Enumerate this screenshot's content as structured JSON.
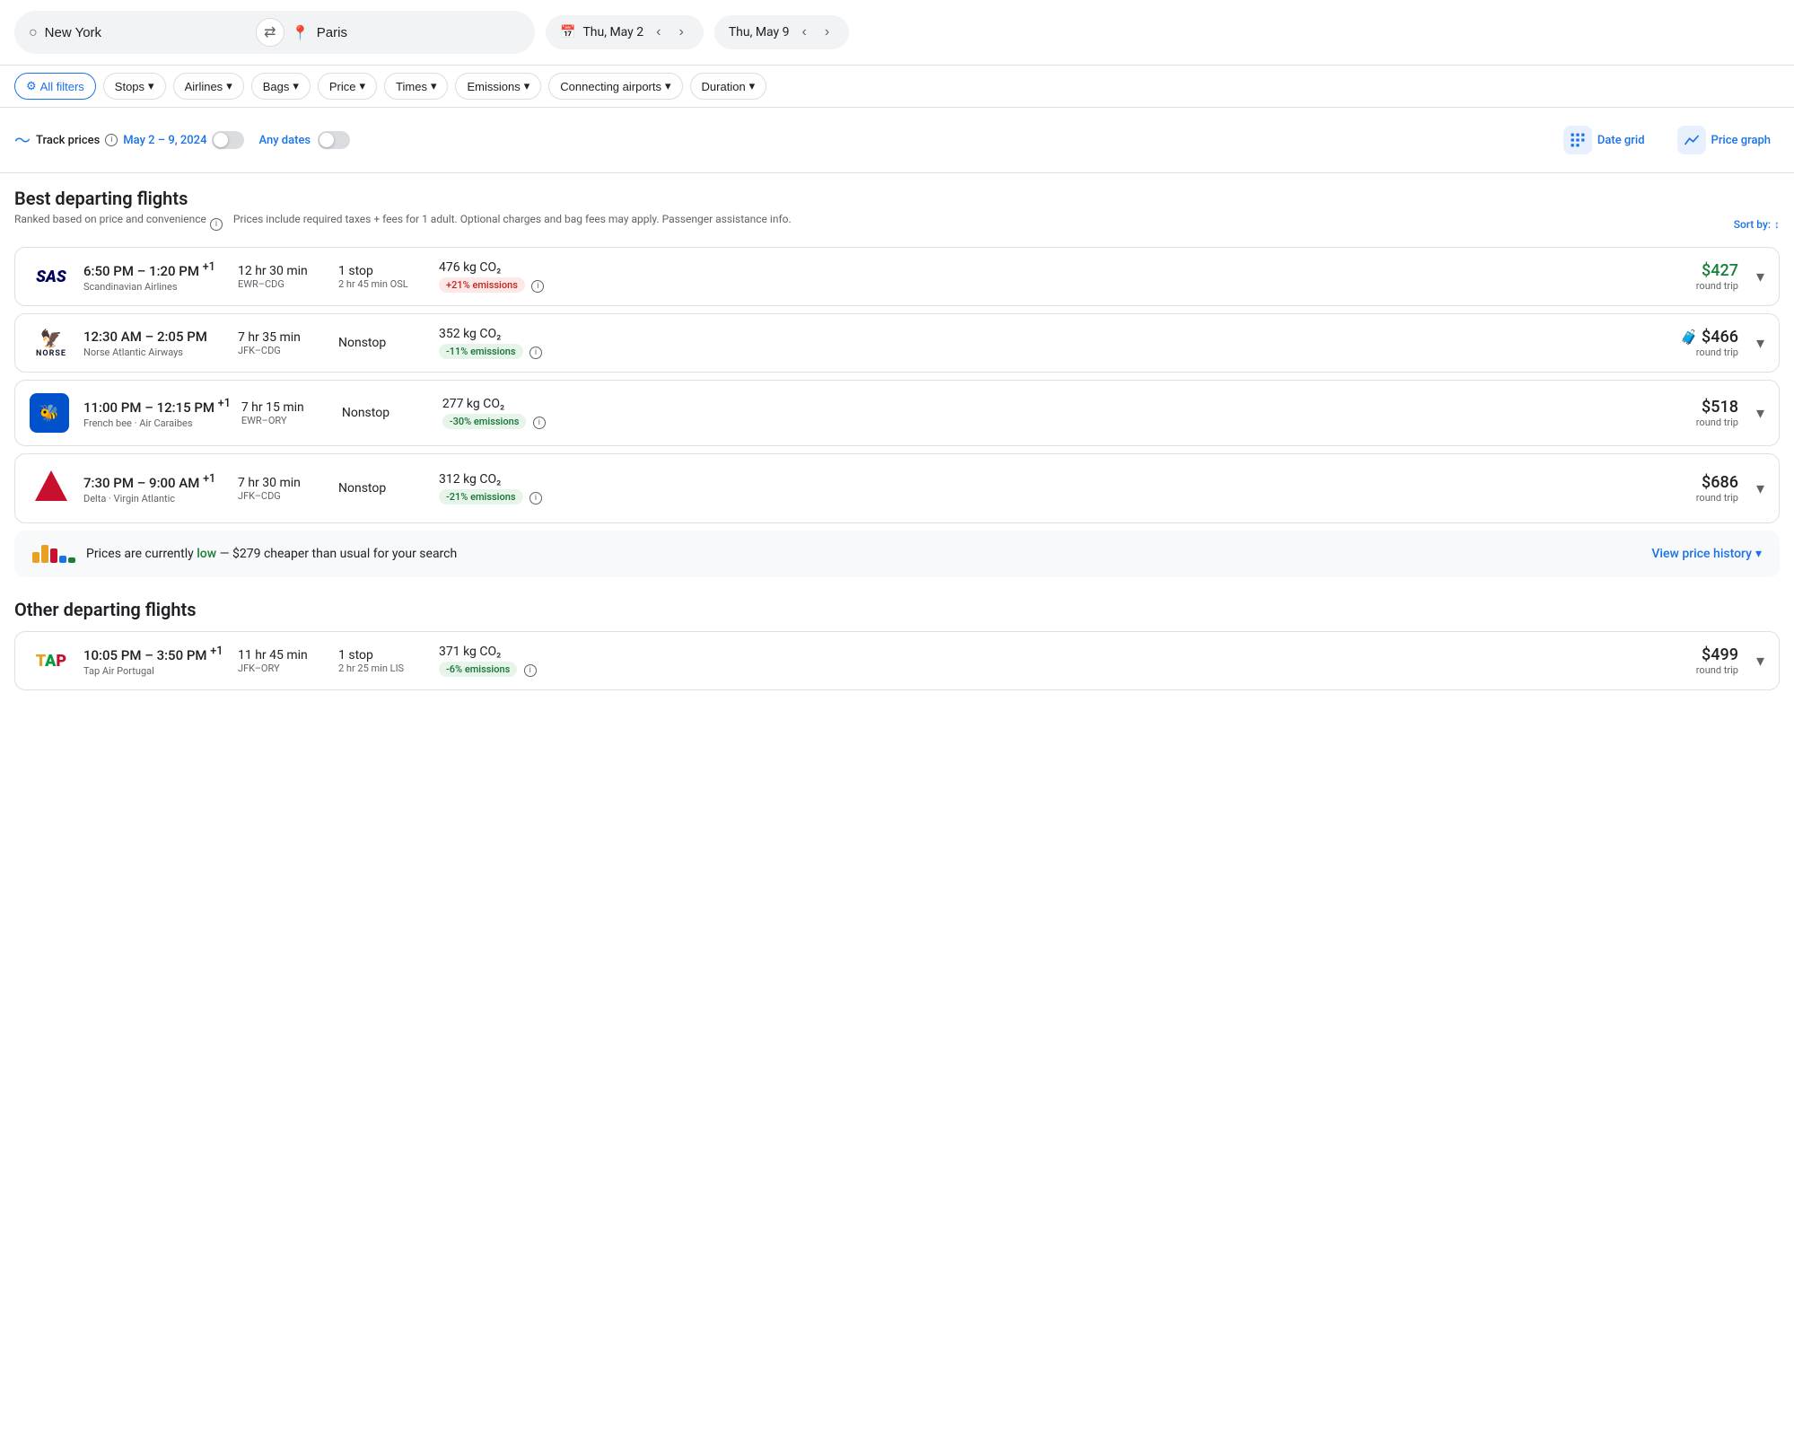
{
  "header": {
    "origin": "New York",
    "swap_label": "⇄",
    "destination_icon": "📍",
    "destination": "Paris",
    "calendar_icon": "📅",
    "depart_date": "Thu, May 2",
    "return_date": "Thu, May 9"
  },
  "filters": {
    "all_filters": "All filters",
    "stops": "Stops",
    "airlines": "Airlines",
    "bags": "Bags",
    "price": "Price",
    "times": "Times",
    "emissions": "Emissions",
    "connecting_airports": "Connecting airports",
    "duration": "Duration"
  },
  "track_bar": {
    "track_icon": "〜",
    "track_label": "Track prices",
    "info_icon": "ℹ",
    "date_range": "May 2 – 9, 2024",
    "any_dates": "Any dates",
    "date_grid_label": "Date grid",
    "price_graph_label": "Price graph"
  },
  "best_flights": {
    "title": "Best departing flights",
    "subtitle": "Ranked based on price and convenience",
    "info": "ℹ",
    "price_note": "Prices include required taxes + fees for 1 adult. Optional charges and bag fees may apply. Passenger assistance info.",
    "sort_label": "Sort by:"
  },
  "flights": [
    {
      "airline_name": "SAS",
      "airline_sub": "Scandinavian Airlines",
      "depart_time": "6:50 PM",
      "arrive_time": "1:20 PM",
      "arrive_suffix": "+1",
      "duration": "12 hr 30 min",
      "route": "EWR–CDG",
      "stops": "1 stop",
      "stop_detail": "2 hr 45 min OSL",
      "co2": "476 kg CO₂",
      "emissions_label": "+21% emissions",
      "emissions_type": "red",
      "price": "$427",
      "price_type": "green",
      "trip": "round trip",
      "has_luggage": false
    },
    {
      "airline_name": "NORSE",
      "airline_sub": "Norse Atlantic Airways",
      "depart_time": "12:30 AM",
      "arrive_time": "2:05 PM",
      "arrive_suffix": "",
      "duration": "7 hr 35 min",
      "route": "JFK–CDG",
      "stops": "Nonstop",
      "stop_detail": "",
      "co2": "352 kg CO₂",
      "emissions_label": "-11% emissions",
      "emissions_type": "green",
      "price": "$466",
      "price_type": "normal",
      "trip": "round trip",
      "has_luggage": true
    },
    {
      "airline_name": "FrenchBee",
      "airline_sub": "French bee · Air Caraibes",
      "depart_time": "11:00 PM",
      "arrive_time": "12:15 PM",
      "arrive_suffix": "+1",
      "duration": "7 hr 15 min",
      "route": "EWR–ORY",
      "stops": "Nonstop",
      "stop_detail": "",
      "co2": "277 kg CO₂",
      "emissions_label": "-30% emissions",
      "emissions_type": "green",
      "price": "$518",
      "price_type": "normal",
      "trip": "round trip",
      "has_luggage": false
    },
    {
      "airline_name": "Delta",
      "airline_sub": "Delta · Virgin Atlantic",
      "depart_time": "7:30 PM",
      "arrive_time": "9:00 AM",
      "arrive_suffix": "+1",
      "duration": "7 hr 30 min",
      "route": "JFK–CDG",
      "stops": "Nonstop",
      "stop_detail": "",
      "co2": "312 kg CO₂",
      "emissions_label": "-21% emissions",
      "emissions_type": "green",
      "price": "$686",
      "price_type": "normal",
      "trip": "round trip",
      "has_luggage": false
    }
  ],
  "price_notice": {
    "text_before": "Prices are currently ",
    "low_text": "low",
    "text_after": " — $279 cheaper than usual for your search",
    "view_history": "View price history"
  },
  "other_flights": {
    "title": "Other departing flights"
  },
  "other_flights_list": [
    {
      "airline_name": "TAP",
      "airline_sub": "Tap Air Portugal",
      "depart_time": "10:05 PM",
      "arrive_time": "3:50 PM",
      "arrive_suffix": "+1",
      "duration": "11 hr 45 min",
      "route": "JFK–ORY",
      "stops": "1 stop",
      "stop_detail": "2 hr 25 min LIS",
      "co2": "371 kg CO₂",
      "emissions_label": "-6% emissions",
      "emissions_type": "green",
      "price": "$499",
      "price_type": "normal",
      "trip": "round trip",
      "has_luggage": false
    }
  ]
}
